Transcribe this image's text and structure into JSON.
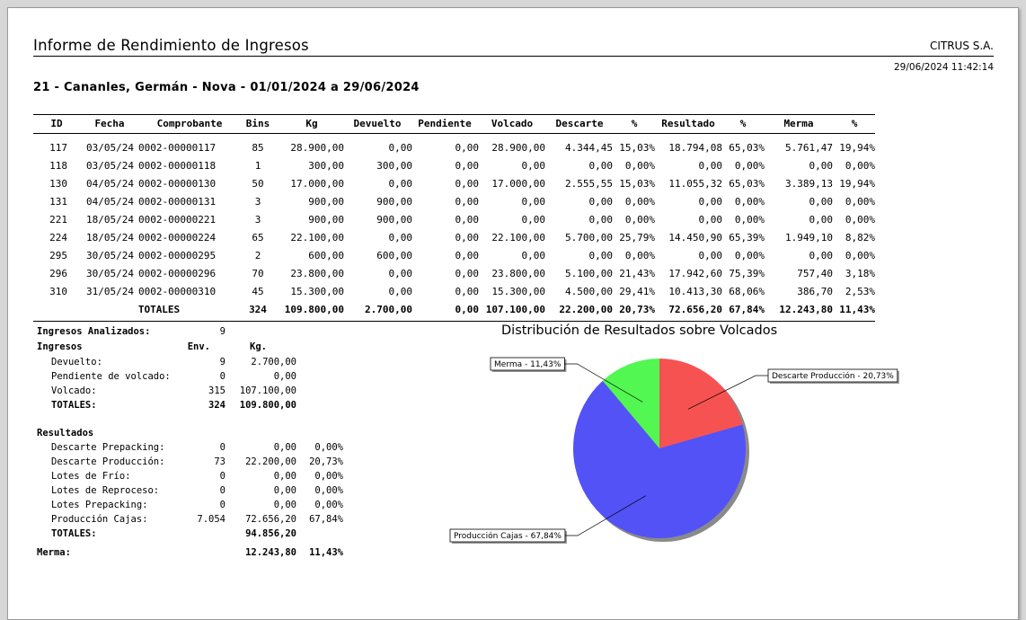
{
  "report": {
    "title": "Informe de Rendimiento de Ingresos",
    "company": "CITRUS S.A.",
    "datetime": "29/06/2024 11:42:14",
    "subtitle": "21 - Cananles, Germán - Nova - 01/01/2024 a 29/06/2024"
  },
  "table": {
    "headers": [
      "ID",
      "Fecha",
      "Comprobante",
      "Bins",
      "Kg",
      "Devuelto",
      "Pendiente",
      "Volcado",
      "Descarte",
      "%",
      "Resultado",
      "%",
      "Merma",
      "%"
    ],
    "rows": [
      [
        "117",
        "03/05/24",
        "0002-00000117",
        "85",
        "28.900,00",
        "0,00",
        "0,00",
        "28.900,00",
        "4.344,45",
        "15,03%",
        "18.794,08",
        "65,03%",
        "5.761,47",
        "19,94%"
      ],
      [
        "118",
        "03/05/24",
        "0002-00000118",
        "1",
        "300,00",
        "300,00",
        "0,00",
        "0,00",
        "0,00",
        "0,00%",
        "0,00",
        "0,00%",
        "0,00",
        "0,00%"
      ],
      [
        "130",
        "04/05/24",
        "0002-00000130",
        "50",
        "17.000,00",
        "0,00",
        "0,00",
        "17.000,00",
        "2.555,55",
        "15,03%",
        "11.055,32",
        "65,03%",
        "3.389,13",
        "19,94%"
      ],
      [
        "131",
        "04/05/24",
        "0002-00000131",
        "3",
        "900,00",
        "900,00",
        "0,00",
        "0,00",
        "0,00",
        "0,00%",
        "0,00",
        "0,00%",
        "0,00",
        "0,00%"
      ],
      [
        "221",
        "18/05/24",
        "0002-00000221",
        "3",
        "900,00",
        "900,00",
        "0,00",
        "0,00",
        "0,00",
        "0,00%",
        "0,00",
        "0,00%",
        "0,00",
        "0,00%"
      ],
      [
        "224",
        "18/05/24",
        "0002-00000224",
        "65",
        "22.100,00",
        "0,00",
        "0,00",
        "22.100,00",
        "5.700,00",
        "25,79%",
        "14.450,90",
        "65,39%",
        "1.949,10",
        "8,82%"
      ],
      [
        "295",
        "30/05/24",
        "0002-00000295",
        "2",
        "600,00",
        "600,00",
        "0,00",
        "0,00",
        "0,00",
        "0,00%",
        "0,00",
        "0,00%",
        "0,00",
        "0,00%"
      ],
      [
        "296",
        "30/05/24",
        "0002-00000296",
        "70",
        "23.800,00",
        "0,00",
        "0,00",
        "23.800,00",
        "5.100,00",
        "21,43%",
        "17.942,60",
        "75,39%",
        "757,40",
        "3,18%"
      ],
      [
        "310",
        "31/05/24",
        "0002-00000310",
        "45",
        "15.300,00",
        "0,00",
        "0,00",
        "15.300,00",
        "4.500,00",
        "29,41%",
        "10.413,30",
        "68,06%",
        "386,70",
        "2,53%"
      ]
    ],
    "totals_label": "TOTALES",
    "totals": [
      "324",
      "109.800,00",
      "2.700,00",
      "0,00",
      "107.100,00",
      "22.200,00",
      "20,73%",
      "72.656,20",
      "67,84%",
      "12.243,80",
      "11,43%"
    ]
  },
  "summary": {
    "analizados_label": "Ingresos Analizados:",
    "analizados_value": "9",
    "ingresos_label": "Ingresos",
    "col_env": "Env.",
    "col_kg": "Kg.",
    "ingresos_rows": [
      {
        "label": "Devuelto:",
        "env": "9",
        "kg": "2.700,00"
      },
      {
        "label": "Pendiente de volcado:",
        "env": "0",
        "kg": "0,00"
      },
      {
        "label": "Volcado:",
        "env": "315",
        "kg": "107.100,00"
      }
    ],
    "ingresos_total": {
      "label": "TOTALES:",
      "env": "324",
      "kg": "109.800,00"
    },
    "resultados_label": "Resultados",
    "resultados_rows": [
      {
        "label": "Descarte Prepacking:",
        "env": "0",
        "kg": "0,00",
        "pct": "0,00%"
      },
      {
        "label": "Descarte Producción:",
        "env": "73",
        "kg": "22.200,00",
        "pct": "20,73%"
      },
      {
        "label": "Lotes de Frío:",
        "env": "0",
        "kg": "0,00",
        "pct": "0,00%"
      },
      {
        "label": "Lotes de Reproceso:",
        "env": "0",
        "kg": "0,00",
        "pct": "0,00%"
      },
      {
        "label": "Lotes Prepacking:",
        "env": "0",
        "kg": "0,00",
        "pct": "0,00%"
      },
      {
        "label": "Producción Cajas:",
        "env": "7.054",
        "kg": "72.656,20",
        "pct": "67,84%"
      }
    ],
    "resultados_total": {
      "label": "TOTALES:",
      "kg": "94.856,20"
    },
    "merma": {
      "label": "Merma:",
      "kg": "12.243,80",
      "pct": "11,43%"
    }
  },
  "chart_data": {
    "type": "pie",
    "title": "Distribución de Resultados sobre Volcados",
    "labels": [
      "Descarte Producción - 20,73%",
      "Producción Cajas - 67,84%",
      "Merma - 11,43%"
    ],
    "values": [
      20.73,
      67.84,
      11.43
    ],
    "colors": [
      "#f75252",
      "#5252f7",
      "#52f752"
    ],
    "legend": "callout labels"
  }
}
